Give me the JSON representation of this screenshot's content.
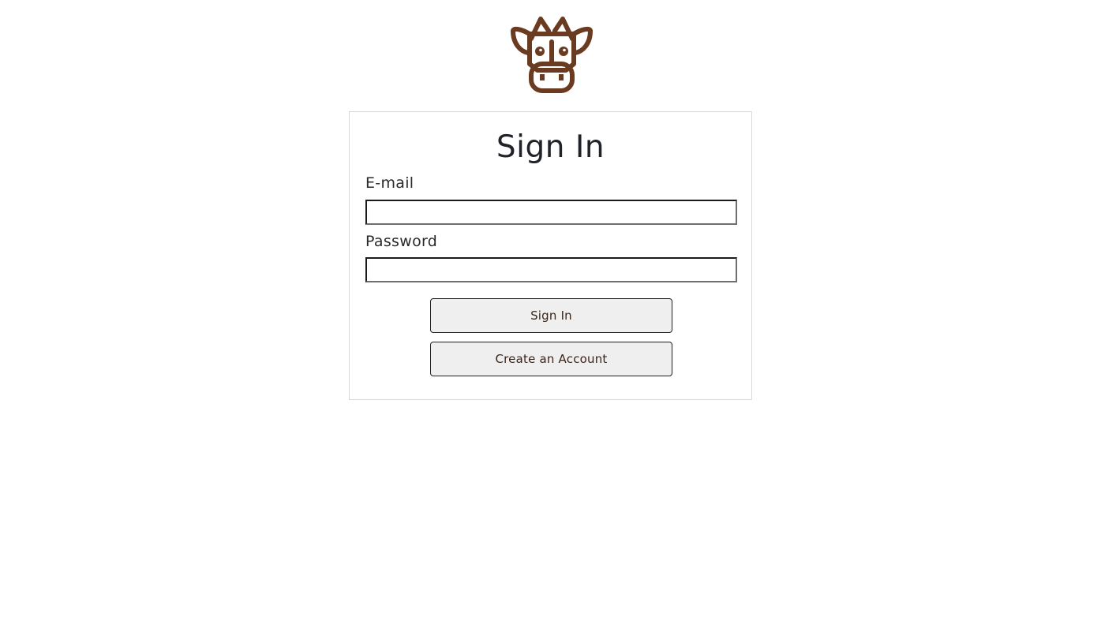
{
  "brand": {
    "logo_icon": "cow-head-icon",
    "logo_color": "#6b3b21"
  },
  "signin": {
    "title": "Sign In",
    "email_label": "E-mail",
    "email_value": "",
    "password_label": "Password",
    "password_value": "",
    "submit_label": "Sign In",
    "create_account_label": "Create an Account"
  },
  "colors": {
    "button_text": "#3d2418",
    "button_bg": "#efefef",
    "card_border": "#d9d9d9"
  }
}
